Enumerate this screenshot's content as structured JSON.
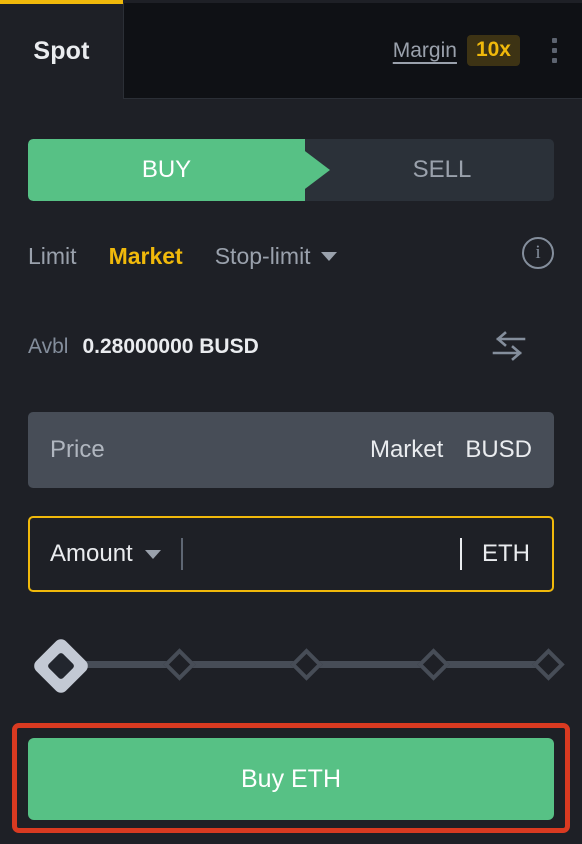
{
  "header": {
    "spot_tab_label": "Spot",
    "margin_link_label": "Margin",
    "leverage_badge": "10x",
    "kebab_icon": "kebab-menu-icon"
  },
  "side_toggle": {
    "buy_label": "BUY",
    "sell_label": "SELL",
    "active": "BUY"
  },
  "order_types": {
    "limit_label": "Limit",
    "market_label": "Market",
    "stop_limit_label": "Stop-limit",
    "active": "Market",
    "info_icon": "info-icon",
    "info_glyph": "i"
  },
  "balance": {
    "label": "Avbl",
    "value": "0.28000000 BUSD",
    "transfer_icon": "transfer-arrows-icon"
  },
  "price_field": {
    "placeholder": "Price",
    "market_label": "Market",
    "unit": "BUSD"
  },
  "amount_field": {
    "label": "Amount",
    "value": "",
    "unit": "ETH"
  },
  "slider": {
    "value_percent": 0,
    "ticks": [
      0,
      25,
      50,
      75,
      100
    ]
  },
  "submit": {
    "label": "Buy ETH"
  },
  "colors": {
    "background": "#1e2026",
    "panel_dark": "#0f1115",
    "accent_yellow": "#f0b90b",
    "buy_green": "#57c185",
    "text_primary": "#eaecef",
    "text_muted": "#848e9c",
    "field_disabled": "#474d57",
    "highlight_red": "#d93a21"
  }
}
